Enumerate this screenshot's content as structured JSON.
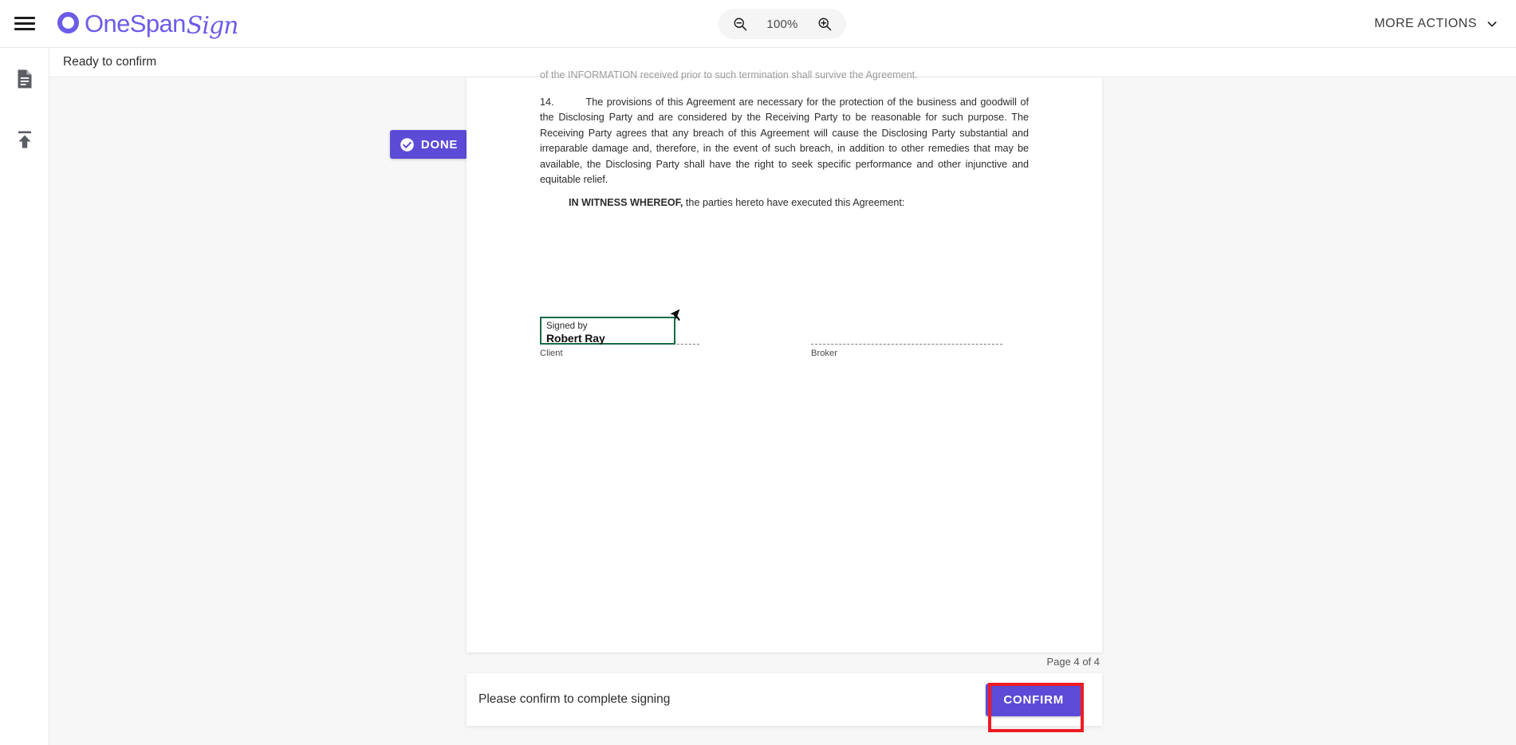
{
  "header": {
    "menu_icon": "hamburger-icon",
    "brand_name": "OneSpan",
    "brand_suffix": "Sign",
    "zoom": {
      "zoom_out_icon": "zoom-out-icon",
      "level": "100%",
      "zoom_in_icon": "zoom-in-icon"
    },
    "more_actions_label": "MORE ACTIONS",
    "more_actions_icon": "chevron-down-icon"
  },
  "sidebar": {
    "items": [
      {
        "name": "documents",
        "icon": "document-icon"
      },
      {
        "name": "upload",
        "icon": "upload-icon"
      }
    ]
  },
  "status": {
    "text": "Ready to confirm"
  },
  "badge": {
    "label": "DONE",
    "icon": "check-circle-icon",
    "color": "#5b4bd6"
  },
  "document": {
    "faded_line": "of the INFORMATION received prior to such termination shall survive the Agreement.",
    "clause_number": "14.",
    "clause_text": "The provisions of this Agreement are necessary for the protection of the business and goodwill of the Disclosing Party and are considered by the Receiving Party to be reasonable for such purpose. The Receiving Party agrees that any breach of this Agreement will cause the Disclosing Party substantial and irreparable damage and, therefore, in the event of such breach, in addition to other remedies that may be available, the Disclosing Party shall have the right to seek specific performance and other injunctive and equitable relief.",
    "witness_bold": "IN WITNESS WHEREOF,",
    "witness_rest": " the parties hereto have executed this Agreement:",
    "signature": {
      "signed_by_label": "Signed by",
      "signer_name": "Robert Ray",
      "box_border_color": "#186b45",
      "cursor_icon": "arrow-cursor-icon"
    },
    "client_label": "Client",
    "broker_label": "Broker",
    "page_indicator": "Page 4 of 4"
  },
  "confirm_bar": {
    "message": "Please confirm to complete signing",
    "button_label": "CONFIRM",
    "button_color": "#5b4bd6",
    "highlight_color": "#ee1b24"
  }
}
